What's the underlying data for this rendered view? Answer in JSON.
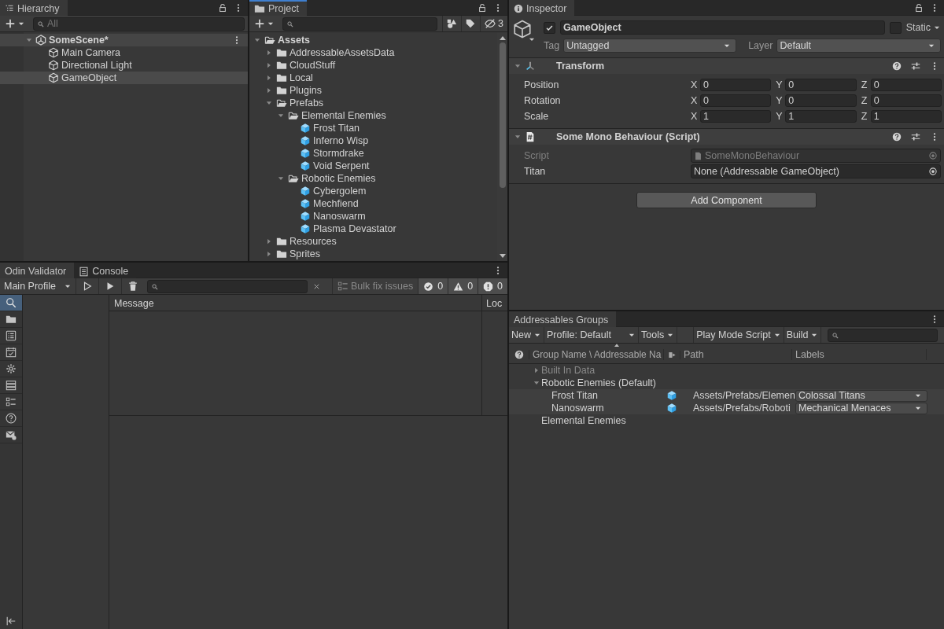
{
  "hierarchy": {
    "title": "Hierarchy",
    "search": {
      "placeholder": "All"
    },
    "scene": {
      "name": "SomeScene*",
      "expanded": true
    },
    "objects": [
      {
        "name": "Main Camera",
        "selected": false
      },
      {
        "name": "Directional Light",
        "selected": false
      },
      {
        "name": "GameObject",
        "selected": true
      }
    ]
  },
  "project": {
    "title": "Project",
    "focused": true,
    "hidden_count": "3",
    "tree": [
      {
        "name": "Assets",
        "kind": "folder",
        "expanded": true,
        "children": [
          {
            "name": "AddressableAssetsData",
            "kind": "folder",
            "expanded": false
          },
          {
            "name": "CloudStuff",
            "kind": "folder",
            "expanded": false
          },
          {
            "name": "Local",
            "kind": "folder",
            "expanded": false
          },
          {
            "name": "Plugins",
            "kind": "folder",
            "expanded": false
          },
          {
            "name": "Prefabs",
            "kind": "folder",
            "expanded": true,
            "children": [
              {
                "name": "Elemental Enemies",
                "kind": "folder",
                "expanded": true,
                "children": [
                  {
                    "name": "Frost Titan",
                    "kind": "prefab"
                  },
                  {
                    "name": "Inferno Wisp",
                    "kind": "prefab"
                  },
                  {
                    "name": "Stormdrake",
                    "kind": "prefab"
                  },
                  {
                    "name": "Void Serpent",
                    "kind": "prefab"
                  }
                ]
              },
              {
                "name": "Robotic Enemies",
                "kind": "folder",
                "expanded": true,
                "children": [
                  {
                    "name": "Cybergolem",
                    "kind": "prefab"
                  },
                  {
                    "name": "Mechfiend",
                    "kind": "prefab"
                  },
                  {
                    "name": "Nanoswarm",
                    "kind": "prefab"
                  },
                  {
                    "name": "Plasma Devastator",
                    "kind": "prefab"
                  }
                ]
              }
            ]
          },
          {
            "name": "Resources",
            "kind": "folder",
            "expanded": false
          },
          {
            "name": "Sprites",
            "kind": "folder",
            "expanded": false
          }
        ]
      }
    ]
  },
  "inspector": {
    "title": "Inspector",
    "object": {
      "active": true,
      "name": "GameObject",
      "static": false,
      "static_label": "Static",
      "tag_label": "Tag",
      "tag": "Untagged",
      "layer_label": "Layer",
      "layer": "Default"
    },
    "components": [
      {
        "kind": "transform",
        "title": "Transform",
        "expanded": true,
        "rows": [
          {
            "label": "Position",
            "fields": [
              {
                "axis": "X",
                "value": "0"
              },
              {
                "axis": "Y",
                "value": "0"
              },
              {
                "axis": "Z",
                "value": "0"
              }
            ]
          },
          {
            "label": "Rotation",
            "fields": [
              {
                "axis": "X",
                "value": "0"
              },
              {
                "axis": "Y",
                "value": "0"
              },
              {
                "axis": "Z",
                "value": "0"
              }
            ]
          },
          {
            "label": "Scale",
            "fields": [
              {
                "axis": "X",
                "value": "1"
              },
              {
                "axis": "Y",
                "value": "1"
              },
              {
                "axis": "Z",
                "value": "1"
              }
            ]
          }
        ]
      },
      {
        "kind": "script",
        "title": "Some Mono Behaviour (Script)",
        "expanded": true,
        "rows": [
          {
            "label": "Script",
            "value": "SomeMonoBehaviour",
            "disabled": true
          },
          {
            "label": "Titan",
            "value": "None (Addressable GameObject)",
            "disabled": false
          }
        ]
      }
    ],
    "add_button": "Add Component"
  },
  "validator": {
    "tabs": [
      {
        "label": "Odin Validator",
        "kind": "plain",
        "selected": true
      },
      {
        "label": "Console",
        "kind": "console",
        "selected": false
      }
    ],
    "profile": "Main Profile",
    "bulk_fix": {
      "label": "Bulk fix issues",
      "disabled": true
    },
    "counters": [
      {
        "kind": "valid",
        "count": "0"
      },
      {
        "kind": "warning",
        "count": "0"
      },
      {
        "kind": "error",
        "count": "0"
      }
    ],
    "sidebar": [
      {
        "kind": "search",
        "selected": true
      },
      {
        "kind": "folder",
        "selected": false
      },
      {
        "kind": "list",
        "selected": false
      },
      {
        "kind": "calendar",
        "selected": false
      },
      {
        "kind": "gear",
        "selected": false
      },
      {
        "kind": "stack",
        "selected": false
      },
      {
        "kind": "checklist",
        "selected": false
      },
      {
        "kind": "question",
        "selected": false
      },
      {
        "kind": "mail",
        "selected": false
      }
    ],
    "columns": [
      "Message",
      "Loc"
    ]
  },
  "addressables": {
    "title": "Addressables Groups",
    "toolbar": [
      {
        "label": "New"
      },
      {
        "label": "Profile: Default"
      },
      {
        "label": "Tools"
      },
      {
        "label": "Play Mode Script"
      },
      {
        "label": "Build"
      }
    ],
    "columns": [
      "Group Name \\ Addressable Na",
      "Path",
      "Labels"
    ],
    "groups": [
      {
        "name": "Built In Data",
        "expanded": false,
        "disabled": true
      },
      {
        "name": "Robotic Enemies (Default)",
        "expanded": true,
        "disabled": false,
        "entries": [
          {
            "name": "Frost Titan",
            "path": "Assets/Prefabs/Elemen",
            "label": "Colossal Titans"
          },
          {
            "name": "Nanoswarm",
            "path": "Assets/Prefabs/Roboti",
            "label": "Mechanical Menaces"
          }
        ]
      },
      {
        "name": "Elemental Enemies",
        "disabled": false
      }
    ]
  }
}
